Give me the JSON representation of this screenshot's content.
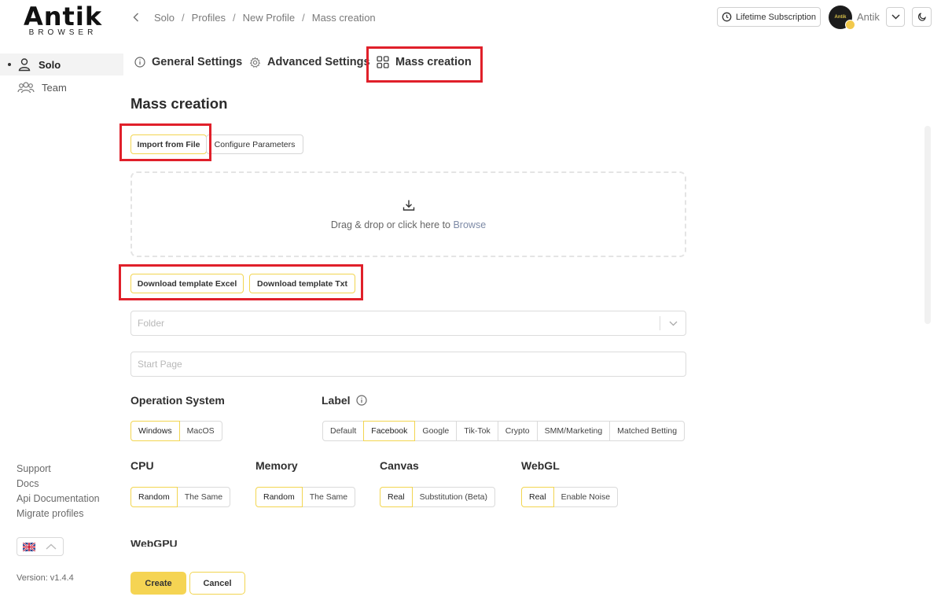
{
  "logo": {
    "main": "Antik",
    "sub": "BROWSER"
  },
  "breadcrumb": [
    "Solo",
    "Profiles",
    "New Profile",
    "Mass creation"
  ],
  "header": {
    "subscription": "Lifetime Subscription",
    "avatar_text": "Antik",
    "user_name": "Antik"
  },
  "sidebar": {
    "items": [
      {
        "label": "Solo",
        "active": true
      },
      {
        "label": "Team",
        "active": false
      }
    ],
    "links": [
      "Support",
      "Docs",
      "Api Documentation",
      "Migrate profiles"
    ],
    "version": "Version: v1.4.4"
  },
  "tabs": [
    "General Settings",
    "Advanced Settings",
    "Mass creation"
  ],
  "page_title": "Mass creation",
  "mode_buttons": {
    "import": "Import from File",
    "configure": "Configure Parameters"
  },
  "dropzone": {
    "text": "Drag & drop or click here to ",
    "link": "Browse"
  },
  "templates": {
    "excel": "Download template Excel",
    "txt": "Download template Txt"
  },
  "fields": {
    "folder_placeholder": "Folder",
    "start_page_placeholder": "Start Page"
  },
  "os": {
    "label": "Operation System",
    "options": [
      "Windows",
      "MacOS"
    ],
    "selected": "Windows"
  },
  "label_group": {
    "label": "Label",
    "options": [
      "Default",
      "Facebook",
      "Google",
      "Tik-Tok",
      "Crypto",
      "SMM/Marketing",
      "Matched Betting"
    ],
    "selected": "Facebook"
  },
  "cpu": {
    "label": "CPU",
    "options": [
      "Random",
      "The Same"
    ],
    "selected": "Random"
  },
  "memory": {
    "label": "Memory",
    "options": [
      "Random",
      "The Same"
    ],
    "selected": "Random"
  },
  "canvas": {
    "label": "Canvas",
    "options": [
      "Real",
      "Substitution (Beta)"
    ],
    "selected": "Real"
  },
  "webgl": {
    "label": "WebGL",
    "options": [
      "Real",
      "Enable Noise"
    ],
    "selected": "Real"
  },
  "next_section": "WebGPU",
  "actions": {
    "create": "Create",
    "cancel": "Cancel"
  },
  "colors": {
    "accent": "#f5d453",
    "highlight": "#e0202a"
  }
}
